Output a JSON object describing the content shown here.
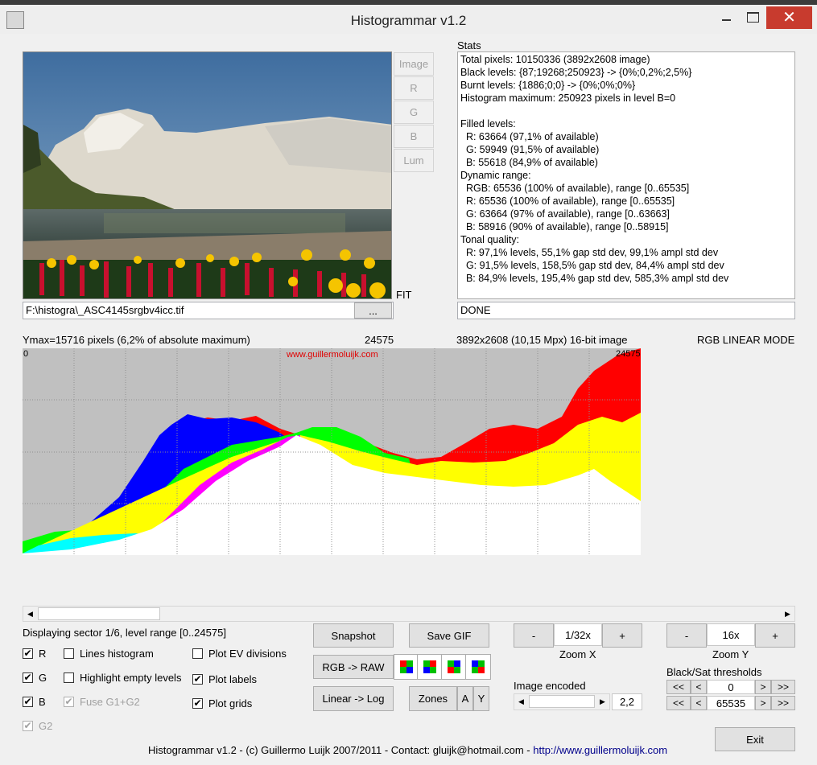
{
  "window": {
    "title": "Histogrammar v1.2"
  },
  "view_buttons": [
    "Image",
    "R",
    "G",
    "B",
    "Lum"
  ],
  "fit_label": "FIT",
  "file_path": "F:\\histogra\\_ASC4145srgbv4icc.tif",
  "browse_label": "...",
  "stats": {
    "title": "Stats",
    "lines": [
      "Total pixels: 10150336 (3892x2608 image)",
      "Black levels: {87;19268;250923} -> {0%;0,2%;2,5%}",
      "Burnt levels: {1886;0;0} -> {0%;0%;0%}",
      "Histogram maximum: 250923 pixels in level B=0",
      "",
      "Filled levels:",
      "  R: 63664 (97,1% of available)",
      "  G: 59949 (91,5% of available)",
      "  B: 55618 (84,9% of available)",
      "Dynamic range:",
      "  RGB: 65536 (100% of available), range [0..65535]",
      "  R: 65536 (100% of available), range [0..65535]",
      "  G: 63664 (97% of available), range [0..63663]",
      "  B: 58916 (90% of available), range [0..58915]",
      "Tonal quality:",
      "  R: 97,1% levels, 55,1% gap std dev, 99,1% ampl std dev",
      "  G: 91,5% levels, 158,5% gap std dev, 84,4% ampl std dev",
      "  B: 84,9% levels, 195,4% gap std dev, 585,3% ampl std dev"
    ],
    "status": "DONE"
  },
  "histogram": {
    "ymax_label": "Ymax=15716 pixels (6,2% of absolute maximum)",
    "level_label": "24575",
    "image_info": "3892x2608 (10,15 Mpx) 16-bit image",
    "mode": "RGB LINEAR MODE",
    "left_level": "0",
    "right_level": "24575",
    "watermark": "www.guillermoluijk.com",
    "colors": {
      "red": "#ff0000",
      "green": "#00ff00",
      "blue": "#0000ff",
      "yellow": "#ffff00",
      "magenta": "#ff00ff",
      "cyan": "#00ffff",
      "white": "#ffffff",
      "bg": "#c0c0c0"
    }
  },
  "sector_label": "Displaying sector 1/6, level range [0..24575]",
  "checkboxes": [
    {
      "label": "R",
      "checked": true,
      "disabled": false
    },
    {
      "label": "G",
      "checked": true,
      "disabled": false
    },
    {
      "label": "B",
      "checked": true,
      "disabled": false
    },
    {
      "label": "G2",
      "checked": true,
      "disabled": true
    },
    {
      "label": "Lines histogram",
      "checked": false,
      "disabled": false
    },
    {
      "label": "Highlight empty levels",
      "checked": false,
      "disabled": false
    },
    {
      "label": "Fuse G1+G2",
      "checked": true,
      "disabled": true
    },
    {
      "label": "Plot EV divisions",
      "checked": false,
      "disabled": false
    },
    {
      "label": "Plot labels",
      "checked": true,
      "disabled": false
    },
    {
      "label": "Plot grids",
      "checked": true,
      "disabled": false
    }
  ],
  "buttons": {
    "snapshot": "Snapshot",
    "save_gif": "Save GIF",
    "rgb_raw": "RGB -> RAW",
    "linear_log": "Linear -> Log",
    "zones": "Zones",
    "a": "A",
    "y": "Y",
    "exit": "Exit",
    "minus": "-",
    "plus": "+",
    "first": "<<",
    "prev": "<",
    "next": ">",
    "last": ">>"
  },
  "zoom_x": {
    "label": "Zoom X",
    "value": "1/32x"
  },
  "zoom_y": {
    "label": "Zoom Y",
    "value": "16x"
  },
  "image_encoded": {
    "label": "Image encoded",
    "value": "2,2"
  },
  "thresholds": {
    "label": "Black/Sat thresholds",
    "black": "0",
    "sat": "65535"
  },
  "footer": {
    "text": "Histogrammar v1.2 - (c) Guillermo Luijk 2007/2011 - Contact: gluijk@hotmail.com - ",
    "link": "http://www.guillermoluijk.com"
  }
}
